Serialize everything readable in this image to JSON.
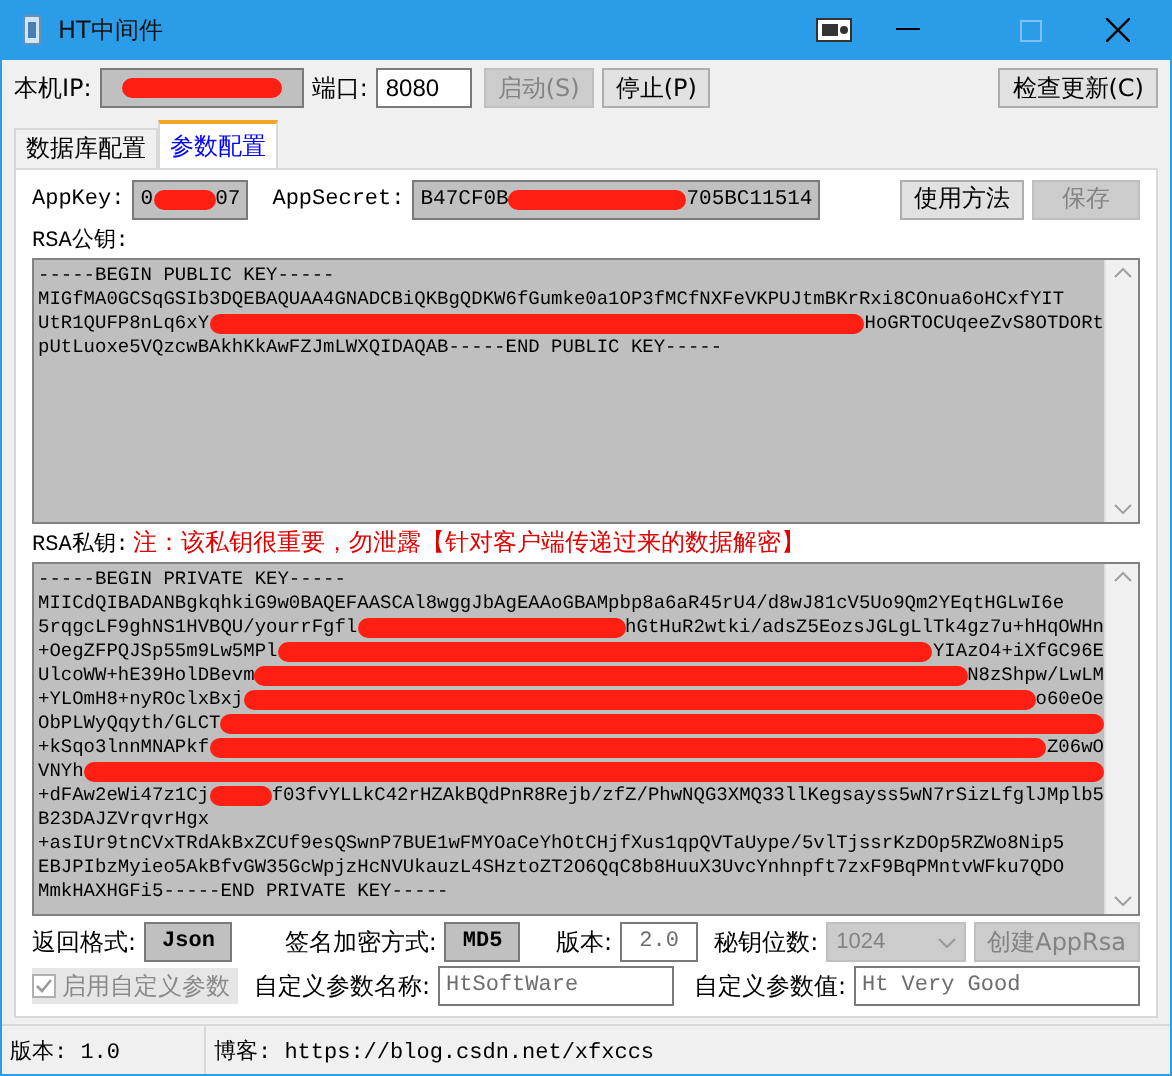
{
  "window": {
    "title": "HT中间件"
  },
  "toolbar": {
    "ip_label": "本机IP:",
    "port_label": "端口:",
    "port": "8080",
    "buttons": [
      {
        "label": "启动(S)",
        "disabled": true
      },
      {
        "label": "停止(P)",
        "disabled": false
      }
    ],
    "update_button": "检查更新(C)"
  },
  "tabs": [
    {
      "label": "数据库配置",
      "selected": false
    },
    {
      "label": "参数配置",
      "selected": true
    }
  ],
  "app": {
    "appkey_label": "AppKey:",
    "appkey": [
      {
        "kind": "text",
        "text": "0"
      },
      {
        "kind": "redacted"
      },
      {
        "kind": "text",
        "text": "07"
      }
    ],
    "appsecret_label": "AppSecret:",
    "appsecret": [
      {
        "kind": "text",
        "text": "B47CF0B"
      },
      {
        "kind": "redacted"
      },
      {
        "kind": "text",
        "text": "705BC11514"
      }
    ],
    "buttons": [
      {
        "label": "使用方法",
        "disabled": false
      },
      {
        "label": "保存",
        "disabled": true
      }
    ]
  },
  "public_key": {
    "label": "RSA公钥:",
    "lines": [
      [
        {
          "kind": "text",
          "text": "-----BEGIN PUBLIC KEY-----"
        }
      ],
      [
        {
          "kind": "text",
          "text": "MIGfMA0GCSqGSIb3DQEBAQUAA4GNADCBiQKBgQDKW6fGumke0a1OP3fMCfNXFeVKPUJtmBKrRxi8COnua6oHCxfYIT"
        }
      ],
      [
        {
          "kind": "text",
          "text": "UtR1QUFP8nLq6xY"
        },
        {
          "kind": "redacted"
        },
        {
          "kind": "text",
          "text": "HoGRTOCUqeeZvS8OTDORt"
        }
      ],
      [
        {
          "kind": "text",
          "text": "pUtLuoxe5VQzcwBAkhKkAwFZJmLWXQIDAQAB-----END PUBLIC KEY-----"
        }
      ]
    ]
  },
  "private_key": {
    "label": "RSA私钥:",
    "note": "注：该私钥很重要，勿泄露【针对客户端传递过来的数据解密】",
    "lines": [
      [
        {
          "kind": "text",
          "text": "-----BEGIN PRIVATE KEY-----"
        }
      ],
      [
        {
          "kind": "text",
          "text": "MIICdQIBADANBgkqhkiG9w0BAQEFAASCAl8wggJbAgEAAoGBAMpbp8a6aR45rU4/d8wJ81cV5Uo9Qm2YEqtHGLwI6e"
        }
      ],
      [
        {
          "kind": "text",
          "text": "5rqgcLF9ghNS1HVBQU/yourrFgfl"
        },
        {
          "kind": "redacted"
        },
        {
          "kind": "text",
          "text": "hGtHuR2wtki/adsZ5EozsJGLgLlTk4gz7u+hHqOWHn"
        }
      ],
      [
        {
          "kind": "text",
          "text": "+OegZFPQJSp55m9Lw5MPl"
        },
        {
          "kind": "redacted"
        },
        {
          "kind": "text",
          "text": "YIAzO4+iXfGC96E"
        }
      ],
      [
        {
          "kind": "text",
          "text": "UlcoWW+hE39HolDBevm"
        },
        {
          "kind": "redacted"
        },
        {
          "kind": "text",
          "text": "N8zShpw/LwLM"
        }
      ],
      [
        {
          "kind": "text",
          "text": "+YLOmH8+nyROclxBxj"
        },
        {
          "kind": "redacted"
        },
        {
          "kind": "text",
          "text": "o60eOe"
        }
      ],
      [
        {
          "kind": "text",
          "text": "ObPLWyQqyth/GLCT"
        },
        {
          "kind": "redacted"
        }
      ],
      [
        {
          "kind": "text",
          "text": "+kSqo3lnnMNAPkf"
        },
        {
          "kind": "redacted"
        },
        {
          "kind": "text",
          "text": "Z06wO"
        }
      ],
      [
        {
          "kind": "text",
          "text": "VNYh"
        },
        {
          "kind": "redacted"
        }
      ],
      [
        {
          "kind": "text",
          "text": "+dFAw2eWi47z1Cj"
        },
        {
          "kind": "redacted"
        },
        {
          "kind": "text",
          "text": "f03fvYLLkC42rHZAkBQdPnR8Rejb/zfZ/PhwNQG3XMQ33llKegsayss5wN7rSizLfglJMplb5"
        }
      ],
      [
        {
          "kind": "text",
          "text": "B23DAJZVrqvrHgx"
        }
      ],
      [
        {
          "kind": "text",
          "text": "+asIUr9tnCVxTRdAkBxZCUf9esQSwnP7BUE1wFMYOaCeYhOtCHjfXus1qpQVTaUype/5vlTjssrKzDOp5RZWo8Nip5"
        }
      ],
      [
        {
          "kind": "text",
          "text": "EBJPIbzMyieo5AkBfvGW35GcWpjzHcNVUkauzL4SHztoZT2O6QqC8b8HuuX3UvcYnhnpft7zxF9BqPMntvWFku7QDO"
        }
      ],
      [
        {
          "kind": "text",
          "text": "MmkHAXHGFi5-----END PRIVATE KEY-----"
        }
      ]
    ]
  },
  "options": {
    "format_label": "返回格式:",
    "format": "Json",
    "sign_label": "签名加密方式:",
    "sign": "MD5",
    "version_label": "版本:",
    "version": "2.0",
    "keybits_label": "秘钥位数:",
    "keybits": "1024",
    "create_button": {
      "label": "创建AppRsa",
      "disabled": true
    },
    "custom_checkbox": {
      "label": "启用自定义参数",
      "checked": true,
      "disabled": true
    },
    "custom_name_label": "自定义参数名称:",
    "custom_name": "HtSoftWare",
    "custom_value_label": "自定义参数值:",
    "custom_value": "Ht Very Good"
  },
  "status_bar": {
    "version": "版本: 1.0",
    "blog": "博客: https://blog.csdn.net/xfxccs"
  }
}
